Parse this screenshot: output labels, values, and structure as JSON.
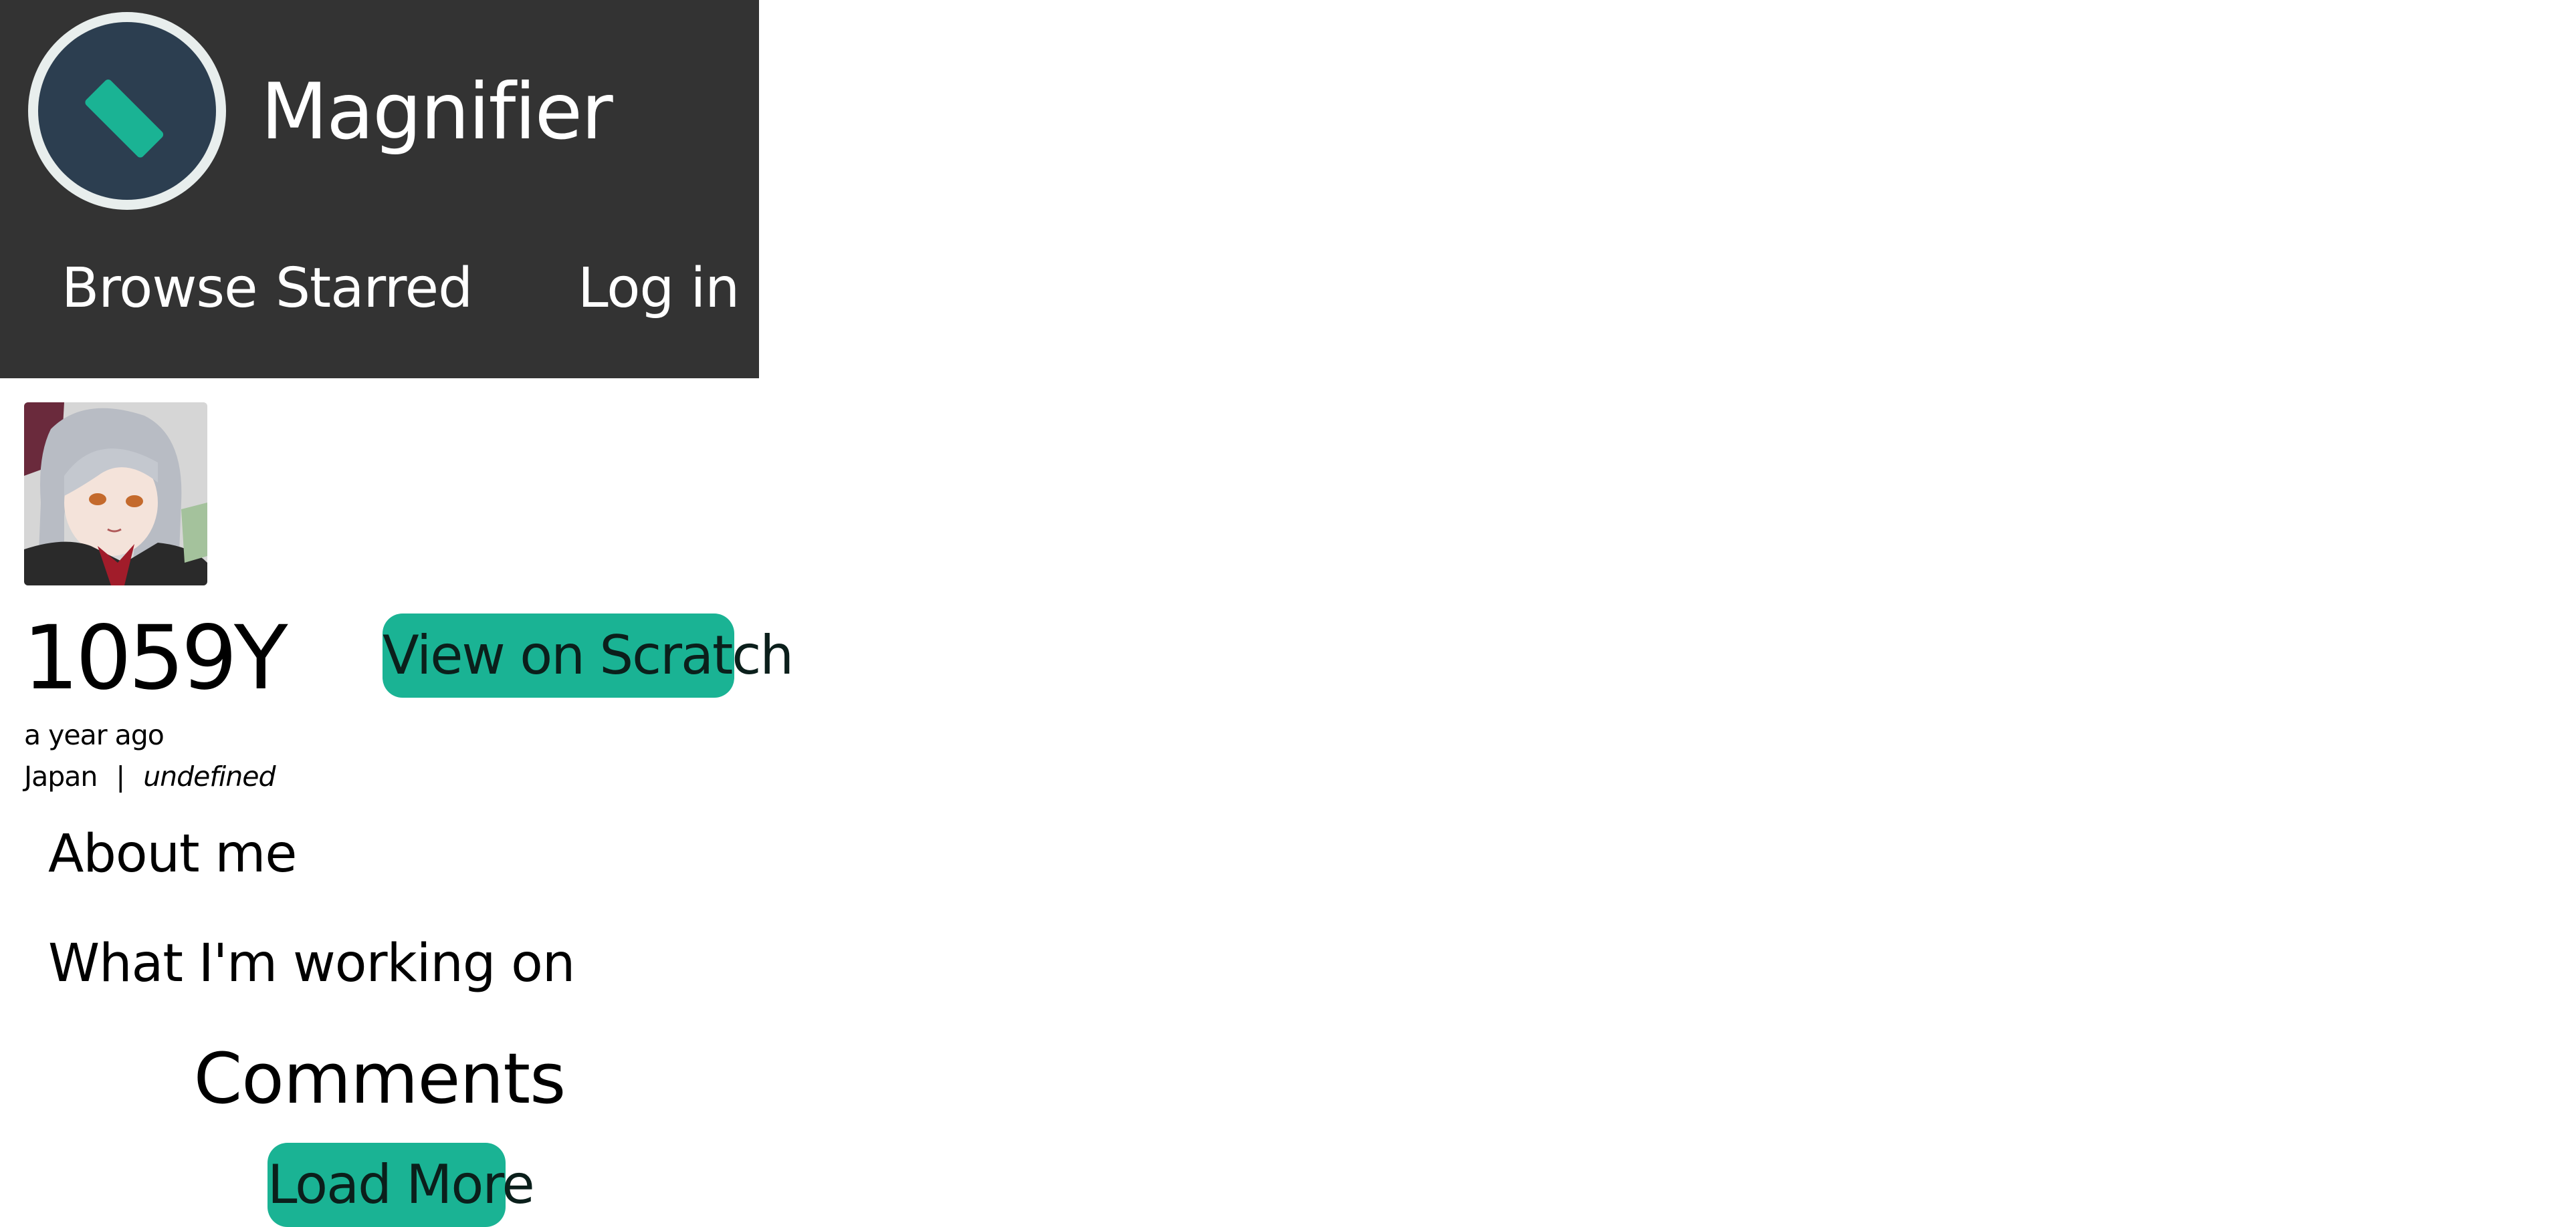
{
  "header": {
    "app_title": "Magnifier",
    "logo_icon": "magnifier-logo-icon",
    "colors": {
      "background": "#333333",
      "logo_ring": "#e8eeed",
      "logo_circle": "#2c3e50",
      "logo_bar": "#1ab394"
    },
    "nav": {
      "browse": "Browse",
      "starred": "Starred",
      "login": "Log in"
    }
  },
  "profile": {
    "username": "1059Y",
    "view_button_label": "View on Scratch",
    "joined": "a year ago",
    "country": "Japan",
    "separator": "|",
    "status": "undefined",
    "avatar": "user-avatar-image"
  },
  "sections": {
    "about_heading": "About me",
    "working_heading": "What I'm working on",
    "comments_heading": "Comments",
    "load_more_label": "Load More"
  },
  "theme": {
    "accent": "#1ab394"
  }
}
